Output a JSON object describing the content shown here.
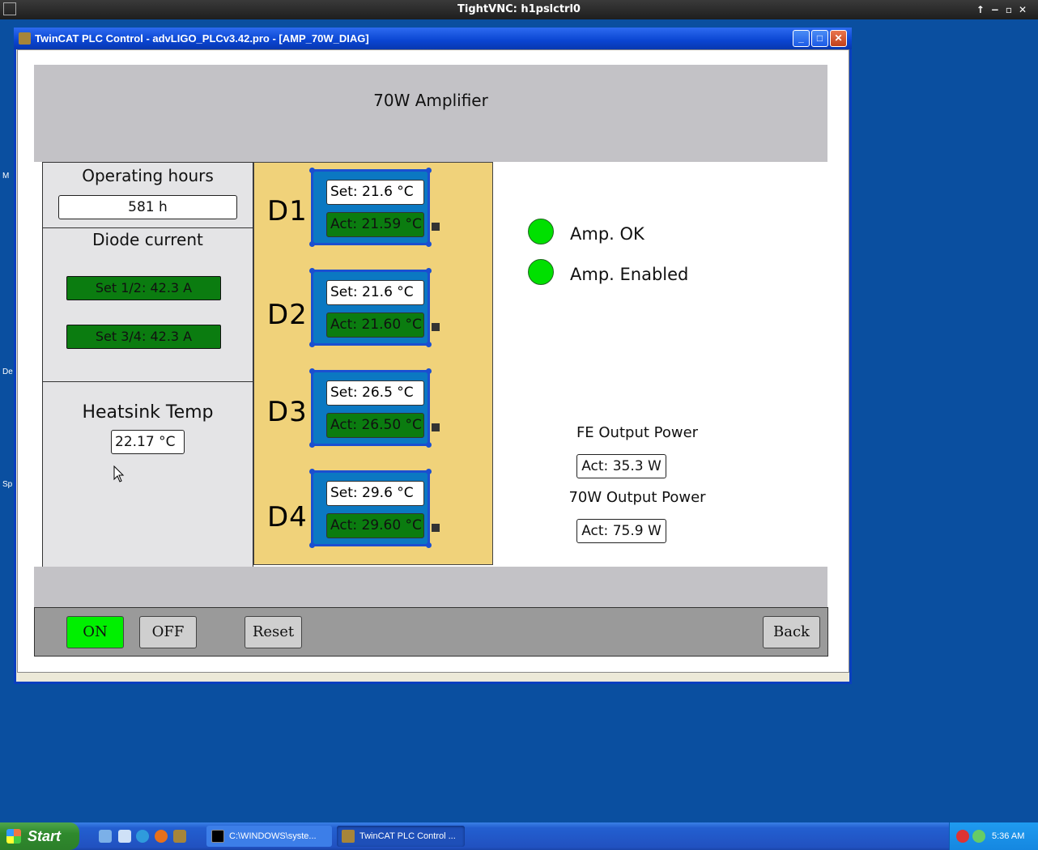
{
  "vnc": {
    "title": "TightVNC: h1pslctrl0"
  },
  "desktop": {
    "frag1": "M",
    "frag2": "De",
    "frag3": "Sp"
  },
  "window": {
    "title": "TwinCAT PLC Control - advLIGO_PLCv3.42.pro - [AMP_70W_DIAG]",
    "min": "_",
    "max": "□",
    "close": "✕"
  },
  "hmi": {
    "title": "70W Amplifier",
    "operating_hours": {
      "label": "Operating hours",
      "value": "581 h"
    },
    "diode_current": {
      "label": "Diode current",
      "set12": "Set 1/2: 42.3 A",
      "set34": "Set 3/4: 42.3 A"
    },
    "heatsink": {
      "label": "Heatsink Temp",
      "value": "22.17 °C"
    },
    "diodes": [
      {
        "name": "D1",
        "set": "Set: 21.6 °C",
        "act": "Act: 21.59 °C"
      },
      {
        "name": "D2",
        "set": "Set: 21.6 °C",
        "act": "Act: 21.60 °C"
      },
      {
        "name": "D3",
        "set": "Set: 26.5 °C",
        "act": "Act: 26.50 °C"
      },
      {
        "name": "D4",
        "set": "Set: 29.6 °C",
        "act": "Act: 29.60 °C"
      }
    ],
    "status": {
      "amp_ok": "Amp. OK",
      "amp_enabled": "Amp. Enabled",
      "led_color": "#00e000"
    },
    "fe_power": {
      "label": "FE Output Power",
      "value": "Act: 35.3 W"
    },
    "out_power": {
      "label": "70W Output Power",
      "value": "Act: 75.9 W"
    },
    "buttons": {
      "on": "ON",
      "off": "OFF",
      "reset": "Reset",
      "back": "Back",
      "on_color": "#00f000"
    }
  },
  "taskbar": {
    "start": "Start",
    "tasks": [
      "C:\\WINDOWS\\syste...",
      "TwinCAT PLC Control ..."
    ],
    "clock": "5:36 AM"
  }
}
